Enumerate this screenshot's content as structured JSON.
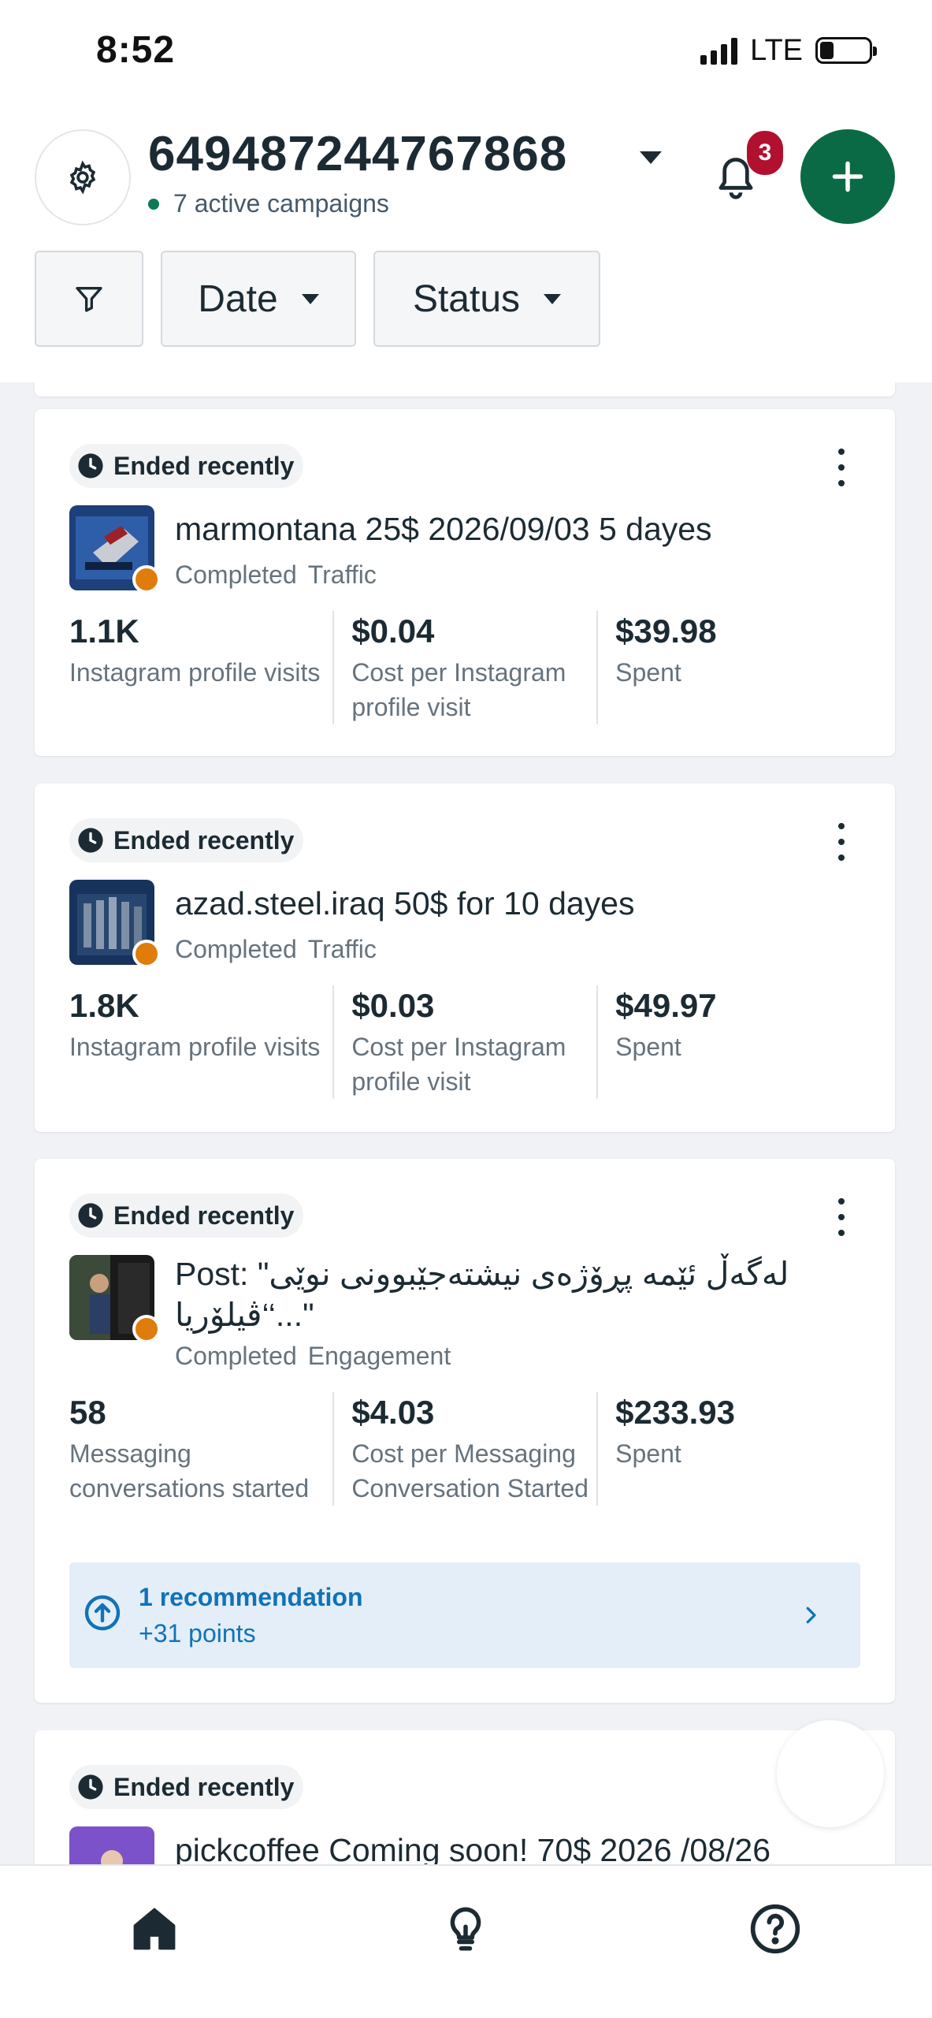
{
  "status_bar": {
    "time": "8:52",
    "network": "LTE"
  },
  "header": {
    "account_id": "649487244767868",
    "active_campaigns": "7 active campaigns",
    "notification_count": "3",
    "filters": {
      "date_label": "Date",
      "status_label": "Status"
    }
  },
  "campaigns": [
    {
      "status_pill": "Ended recently",
      "name": "marmontana 25$ 2026/09/03 5 dayes",
      "status": "Completed",
      "objective": "Traffic",
      "metrics": [
        {
          "value": "1.1K",
          "label": "Instagram profile visits"
        },
        {
          "value": "$0.04",
          "label": "Cost per Instagram profile visit"
        },
        {
          "value": "$39.98",
          "label": "Spent"
        }
      ]
    },
    {
      "status_pill": "Ended recently",
      "name": "azad.steel.iraq 50$ for 10 dayes",
      "status": "Completed",
      "objective": "Traffic",
      "metrics": [
        {
          "value": "1.8K",
          "label": "Instagram profile visits"
        },
        {
          "value": "$0.03",
          "label": "Cost per Instagram profile visit"
        },
        {
          "value": "$49.97",
          "label": "Spent"
        }
      ]
    },
    {
      "status_pill": "Ended recently",
      "name": "Post: \"لەگەڵ ئێمە پڕۆژەی نیشتەجێبوونی نوێی ڤیلۆریا‘‘...\"",
      "status": "Completed",
      "objective": "Engagement",
      "metrics": [
        {
          "value": "58",
          "label": "Messaging conversations started"
        },
        {
          "value": "$4.03",
          "label": "Cost per Messaging Conversation Started"
        },
        {
          "value": "$233.93",
          "label": "Spent"
        }
      ],
      "recommendation": {
        "title": "1 recommendation",
        "points": "+31 points"
      }
    },
    {
      "status_pill": "Ended recently",
      "name": "pickcoffee Coming soon! 70$ 2026 /08/26"
    }
  ],
  "colors": {
    "primary_green": "#0a6a46",
    "badge_red": "#b2102f",
    "delivery_dot": "#df7c0b",
    "link_blue": "#1172b8"
  },
  "tabs": [
    "home-icon",
    "lightbulb-icon",
    "help-icon"
  ]
}
